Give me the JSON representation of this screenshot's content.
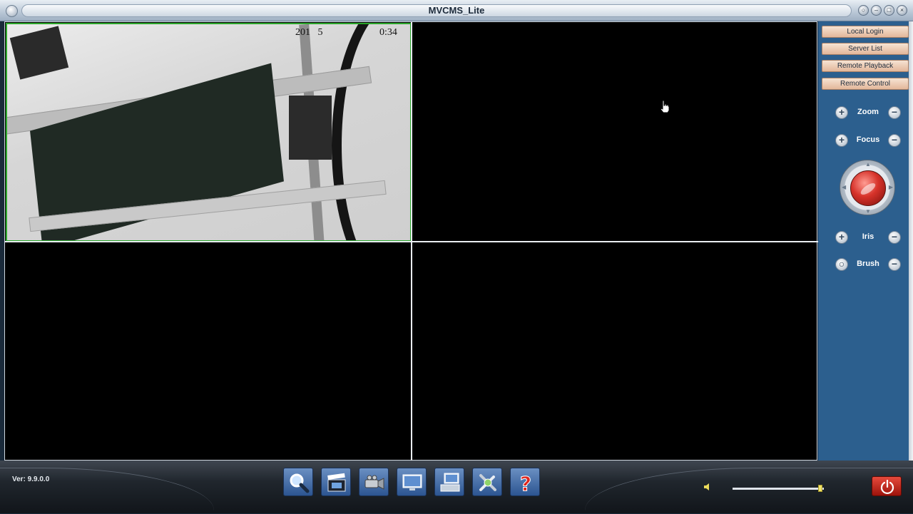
{
  "window": {
    "title": "MVCMS_Lite"
  },
  "video": {
    "osd_date": "201",
    "osd_date_tail": "5",
    "osd_time": "0:34"
  },
  "sidebar": {
    "buttons": [
      {
        "label": "Local Login"
      },
      {
        "label": "Server List"
      },
      {
        "label": "Remote Playback"
      },
      {
        "label": "Remote Control"
      }
    ],
    "ptz": [
      {
        "label": "Zoom"
      },
      {
        "label": "Focus"
      },
      {
        "label": "Iris"
      },
      {
        "label": "Brush"
      }
    ]
  },
  "footer": {
    "version": "Ver: 9.9.0.0",
    "tools": [
      "search-icon",
      "clapperboard-icon",
      "camera-icon",
      "monitor-icon",
      "network-computer-icon",
      "tools-icon",
      "help-icon"
    ],
    "volume_level": 0.98
  },
  "colors": {
    "active_cell_border": "#2aa52a",
    "sidebar_bg": "#2c5f8e",
    "side_button": "#e3b79a",
    "power": "#d6322a"
  }
}
